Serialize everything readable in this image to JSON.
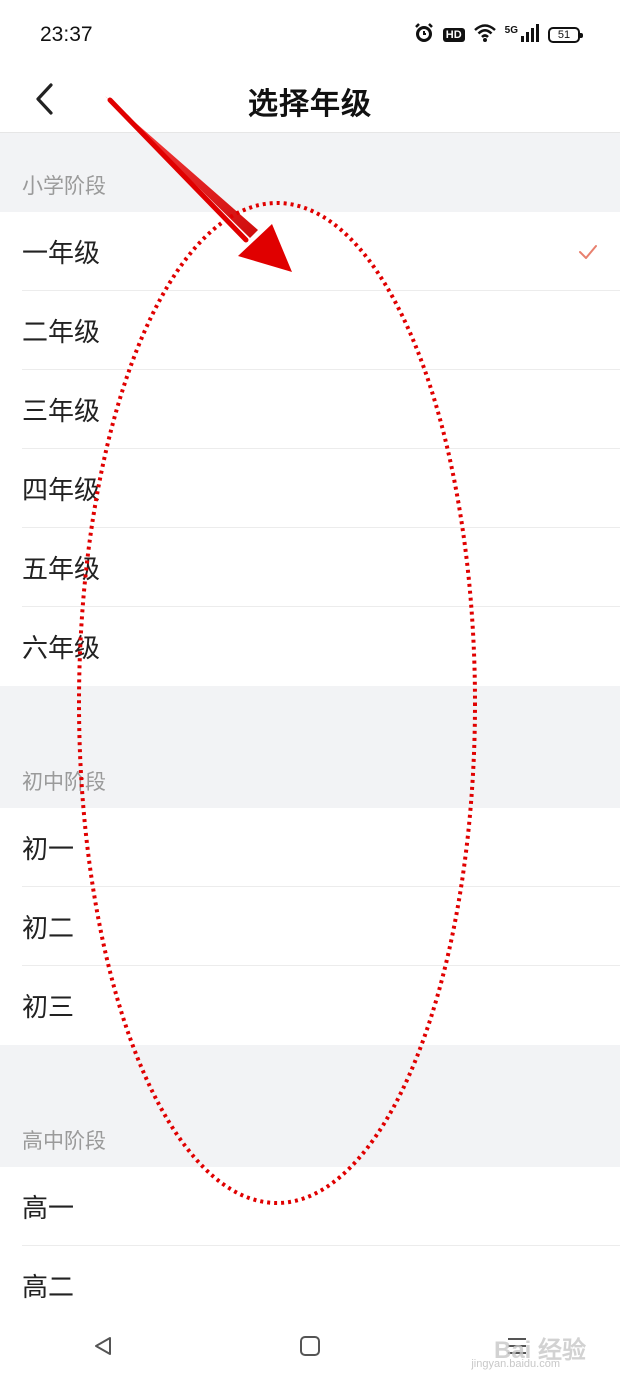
{
  "status_bar": {
    "time": "23:37",
    "hd_badge": "HD",
    "network": "5G",
    "battery": "51",
    "icons": [
      "alarm-icon",
      "hd-icon",
      "wifi-icon",
      "signal-icon",
      "battery-icon"
    ]
  },
  "header": {
    "title": "选择年级",
    "back_icon": "back-arrow-icon"
  },
  "sections": [
    {
      "title": "小学阶段",
      "items": [
        {
          "label": "一年级",
          "selected": true
        },
        {
          "label": "二年级",
          "selected": false
        },
        {
          "label": "三年级",
          "selected": false
        },
        {
          "label": "四年级",
          "selected": false
        },
        {
          "label": "五年级",
          "selected": false
        },
        {
          "label": "六年级",
          "selected": false
        }
      ]
    },
    {
      "title": "初中阶段",
      "items": [
        {
          "label": "初一",
          "selected": false
        },
        {
          "label": "初二",
          "selected": false
        },
        {
          "label": "初三",
          "selected": false
        }
      ]
    },
    {
      "title": "高中阶段",
      "items": [
        {
          "label": "高一",
          "selected": false
        },
        {
          "label": "高二",
          "selected": false
        }
      ]
    }
  ],
  "nav_bar": {
    "icons": [
      "back-triangle-icon",
      "home-square-icon",
      "menu-lines-icon"
    ]
  },
  "watermark": {
    "text": "Bai 经验",
    "sub": "jingyan.baidu.com"
  },
  "colors": {
    "accent_check": "#e8806e",
    "annotation_red": "#e00000",
    "section_bg": "#f2f3f5"
  }
}
